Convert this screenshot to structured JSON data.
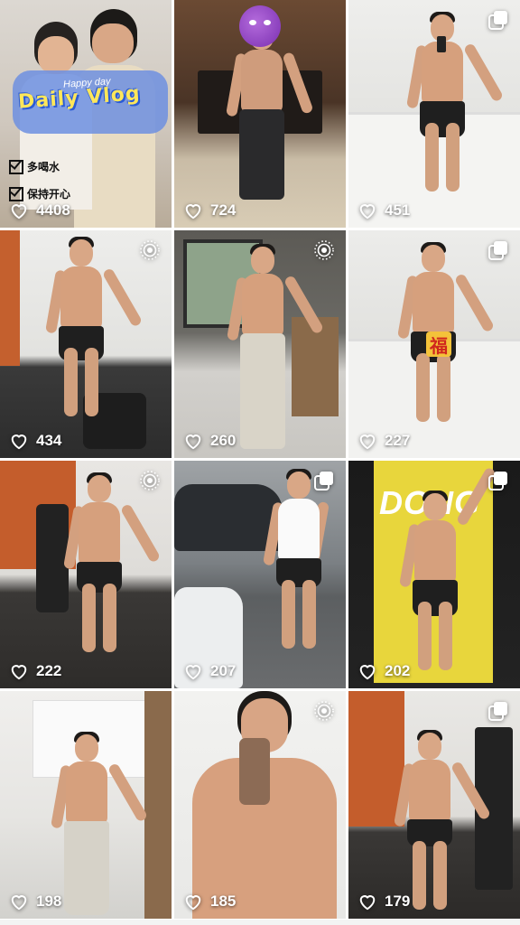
{
  "feed": {
    "posts": [
      {
        "likes": "4408",
        "badge": "none",
        "overlay": {
          "subtitle": "Happy day",
          "title": "Daily Vlog",
          "checks": [
            "多喝水",
            "保持开心"
          ]
        }
      },
      {
        "likes": "724",
        "badge": "none"
      },
      {
        "likes": "451",
        "badge": "multi-image"
      },
      {
        "likes": "434",
        "badge": "live-photo"
      },
      {
        "likes": "260",
        "badge": "live-photo"
      },
      {
        "likes": "227",
        "badge": "multi-image",
        "sticker": "福"
      },
      {
        "likes": "222",
        "badge": "live-photo"
      },
      {
        "likes": "207",
        "badge": "multi-image"
      },
      {
        "likes": "202",
        "badge": "multi-image",
        "sign": "DONG"
      },
      {
        "likes": "198",
        "badge": "none"
      },
      {
        "likes": "185",
        "badge": "live-photo"
      },
      {
        "likes": "179",
        "badge": "multi-image"
      }
    ]
  },
  "icons": {
    "like": "heart-outline-icon",
    "multi_image": "stacked-squares-icon",
    "live_photo": "live-photo-rings-icon"
  },
  "colors": {
    "overlay_text": "#ffffff",
    "vlog_title": "#ffe75a",
    "vlog_outline": "#2a5bd6",
    "dong_sign": "#e8d63c"
  }
}
